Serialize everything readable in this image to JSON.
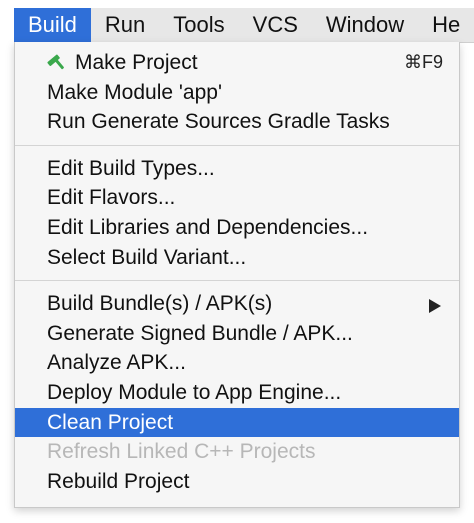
{
  "menubar": {
    "items": [
      "Build",
      "Run",
      "Tools",
      "VCS",
      "Window",
      "He"
    ]
  },
  "menu": {
    "group1": {
      "make_project": "Make Project",
      "make_project_shortcut": "⌘F9",
      "make_module": "Make Module 'app'",
      "run_generate": "Run Generate Sources Gradle Tasks"
    },
    "group2": {
      "edit_build_types": "Edit Build Types...",
      "edit_flavors": "Edit Flavors...",
      "edit_libraries": "Edit Libraries and Dependencies...",
      "select_build_variant": "Select Build Variant..."
    },
    "group3": {
      "build_bundle": "Build Bundle(s) / APK(s)",
      "generate_signed": "Generate Signed Bundle / APK...",
      "analyze_apk": "Analyze APK...",
      "deploy_module": "Deploy Module to App Engine...",
      "clean_project": "Clean Project",
      "refresh_linked": "Refresh Linked C++ Projects",
      "rebuild_project": "Rebuild Project"
    }
  },
  "icons": {
    "make_project": "hammer-icon",
    "build_bundle_submenu": "chevron-right-icon"
  },
  "colors": {
    "highlight": "#2f6fd8",
    "disabled_text": "#b7b7b7",
    "hammer": "#3aa84c"
  }
}
